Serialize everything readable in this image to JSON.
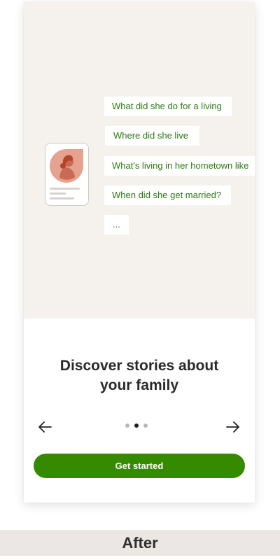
{
  "colors": {
    "accent": "#368a00",
    "chip_text": "#2b7a12",
    "hero_bg": "#f5f2ee",
    "avatar_bg": "#e5a28f",
    "avatar_dark": "#b5452a"
  },
  "prompts": [
    "What did she do for a living",
    "Where did she live",
    "What's living in her hometown like",
    "When did she get married?",
    "..."
  ],
  "headline": "Discover stories about your family",
  "pager": {
    "total": 3,
    "active_index": 1
  },
  "cta": {
    "label": "Get started"
  },
  "footer": {
    "label": "After"
  },
  "icons": {
    "back": "arrow-left-icon",
    "next": "arrow-right-icon",
    "avatar": "person-silhouette-icon"
  }
}
